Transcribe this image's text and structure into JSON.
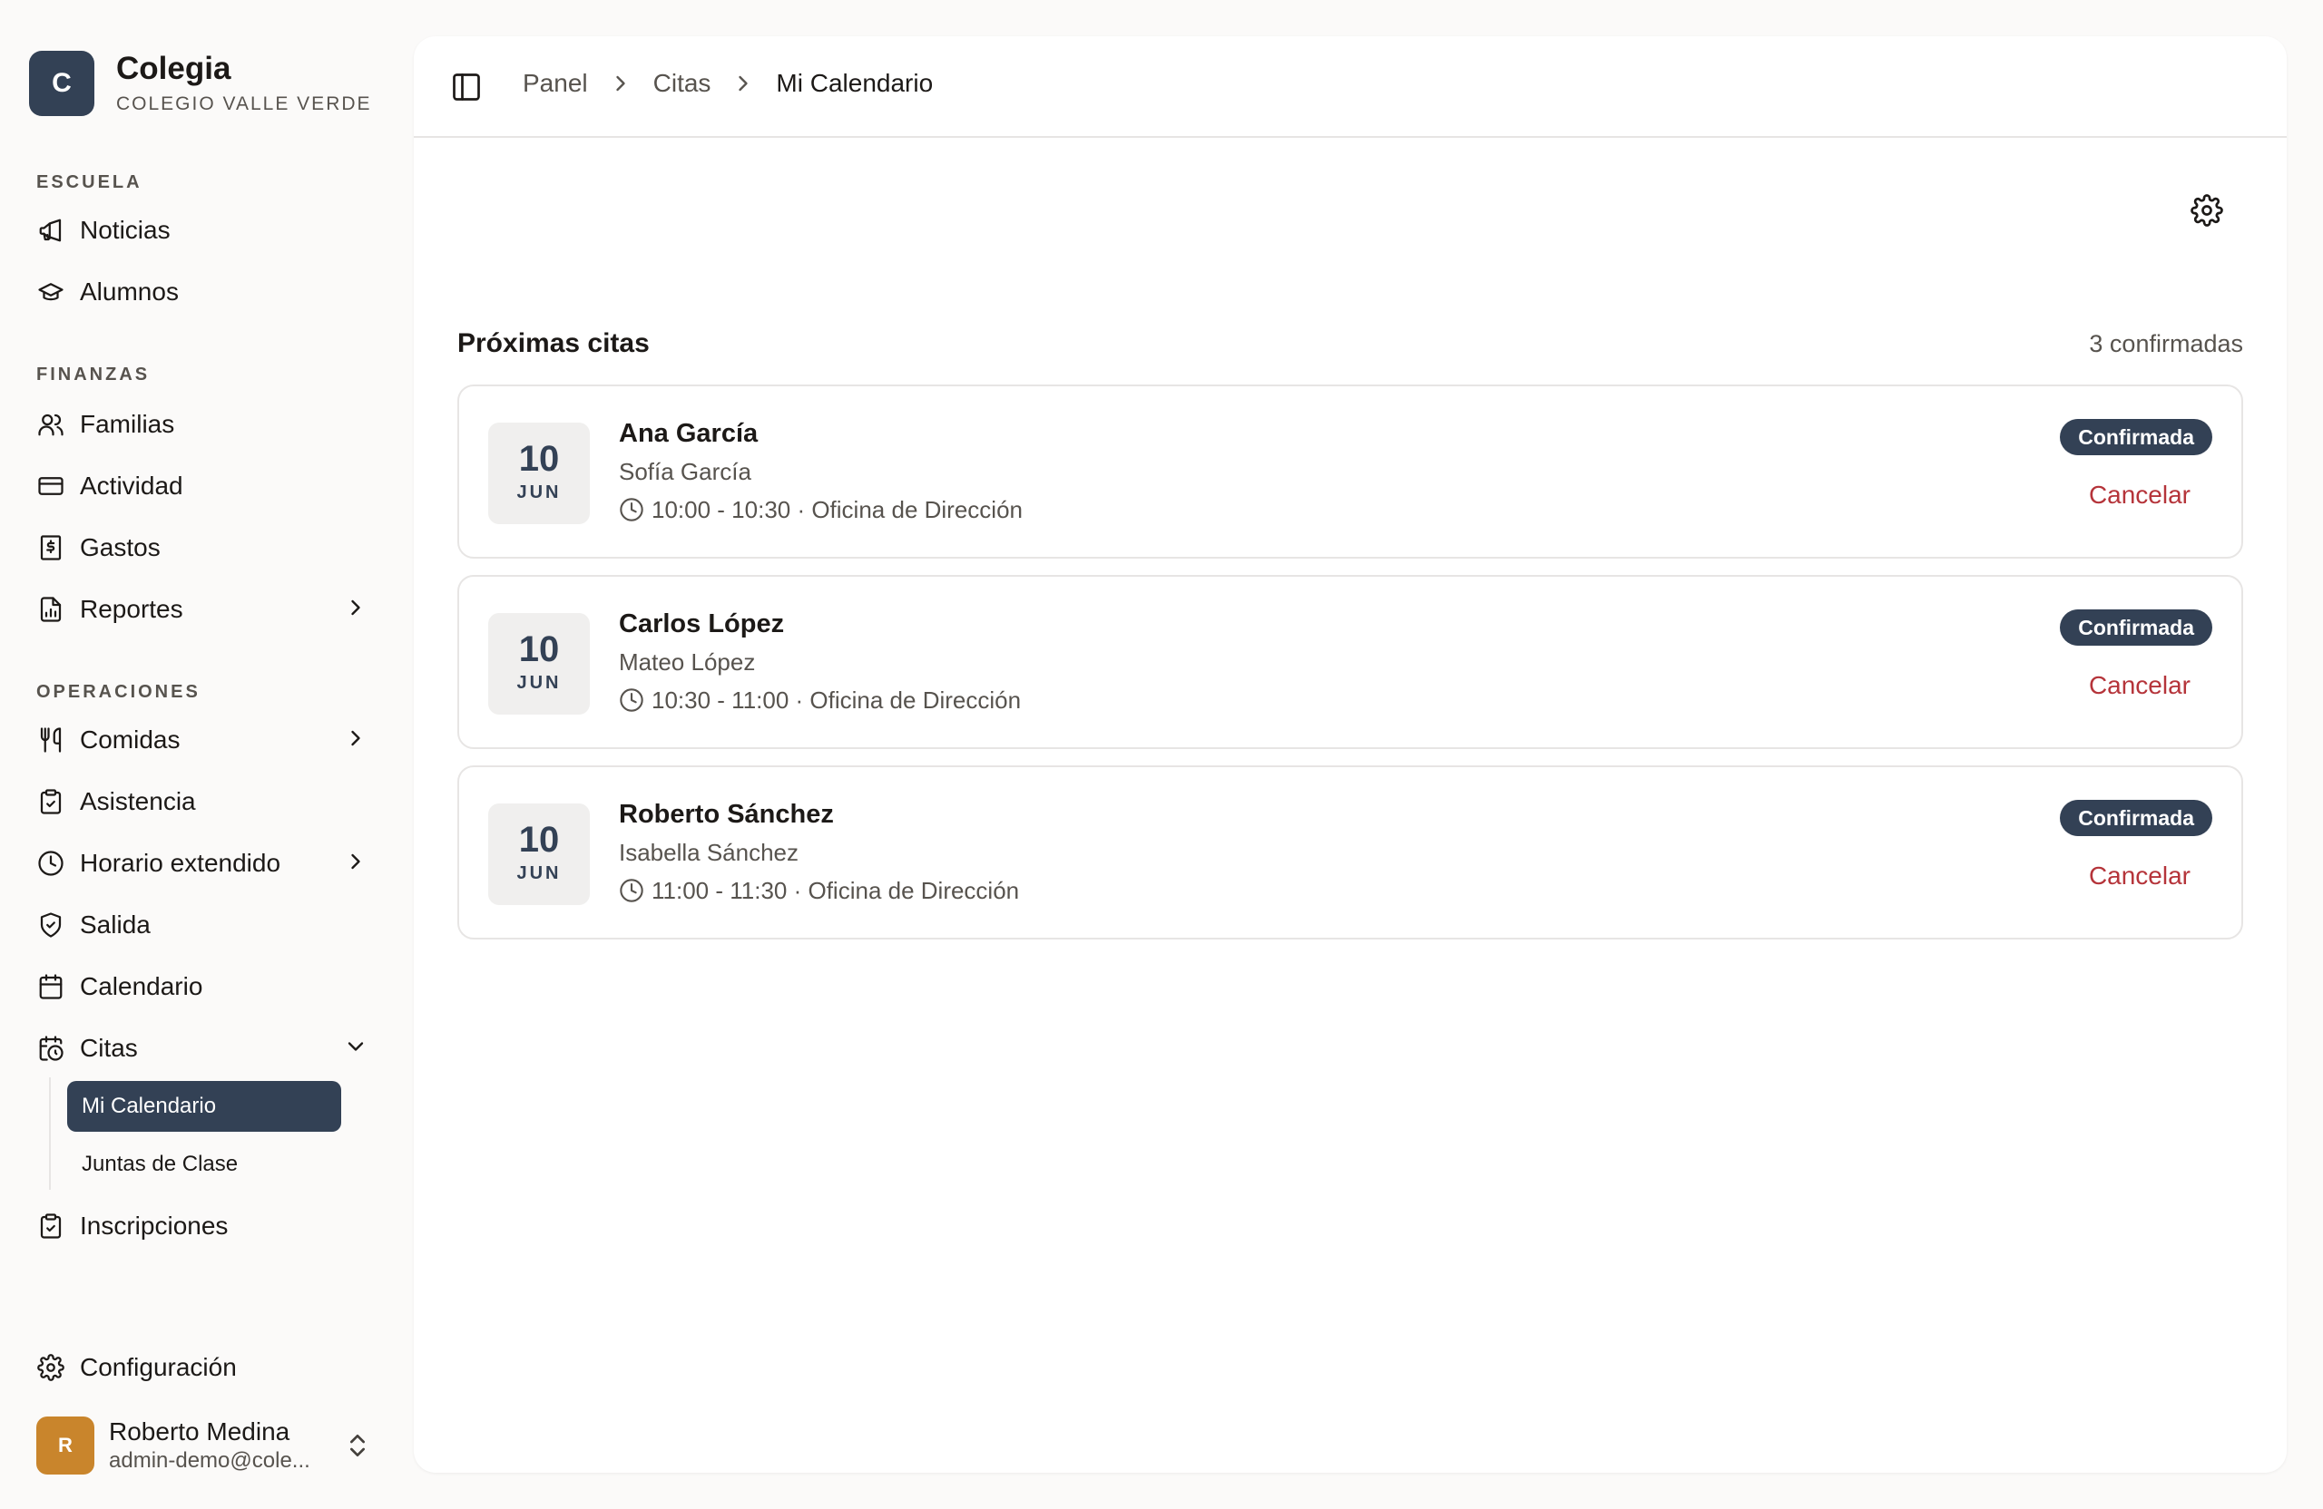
{
  "brand": {
    "initial": "C",
    "name": "Colegia",
    "subtitle": "COLEGIO VALLE VERDE"
  },
  "sidebar": {
    "sections": [
      {
        "label": "ESCUELA",
        "items": [
          {
            "label": "Noticias",
            "icon": "megaphone-icon"
          },
          {
            "label": "Alumnos",
            "icon": "graduation-cap-icon"
          }
        ]
      },
      {
        "label": "FINANZAS",
        "items": [
          {
            "label": "Familias",
            "icon": "users-icon"
          },
          {
            "label": "Actividad",
            "icon": "credit-card-icon"
          },
          {
            "label": "Gastos",
            "icon": "receipt-icon"
          },
          {
            "label": "Reportes",
            "icon": "report-icon"
          }
        ]
      },
      {
        "label": "OPERACIONES",
        "items": [
          {
            "label": "Comidas",
            "icon": "utensils-icon"
          },
          {
            "label": "Asistencia",
            "icon": "clipboard-check-icon"
          },
          {
            "label": "Horario extendido",
            "icon": "clock-icon"
          },
          {
            "label": "Salida",
            "icon": "shield-check-icon"
          },
          {
            "label": "Calendario",
            "icon": "calendar-icon"
          },
          {
            "label": "Citas",
            "icon": "calendar-clock-icon"
          },
          {
            "label": "Inscripciones",
            "icon": "clipboard-check-icon"
          }
        ]
      }
    ],
    "citas_sub": [
      {
        "label": "Mi Calendario",
        "active": true
      },
      {
        "label": "Juntas de Clase",
        "active": false
      }
    ],
    "settings": {
      "label": "Configuración",
      "icon": "gear-icon"
    },
    "user": {
      "initial": "R",
      "name": "Roberto Medina",
      "email": "admin-demo@cole..."
    }
  },
  "breadcrumb": [
    "Panel",
    "Citas",
    "Mi Calendario"
  ],
  "main": {
    "title": "Próximas citas",
    "count": "3 confirmadas",
    "appointments": [
      {
        "day": "10",
        "month": "JUN",
        "parent": "Ana García",
        "student": "Sofía García",
        "details": "10:00 - 10:30 · Oficina de Dirección",
        "status": "Confirmada",
        "action": "Cancelar"
      },
      {
        "day": "10",
        "month": "JUN",
        "parent": "Carlos López",
        "student": "Mateo López",
        "details": "10:30 - 11:00 · Oficina de Dirección",
        "status": "Confirmada",
        "action": "Cancelar"
      },
      {
        "day": "10",
        "month": "JUN",
        "parent": "Roberto Sánchez",
        "student": "Isabella Sánchez",
        "details": "11:00 - 11:30 · Oficina de Dirección",
        "status": "Confirmada",
        "action": "Cancelar"
      }
    ]
  },
  "colors": {
    "primary": "#334155",
    "accent_user": "#c9852c",
    "danger": "#b5343a",
    "background": "#fbfaf9"
  }
}
